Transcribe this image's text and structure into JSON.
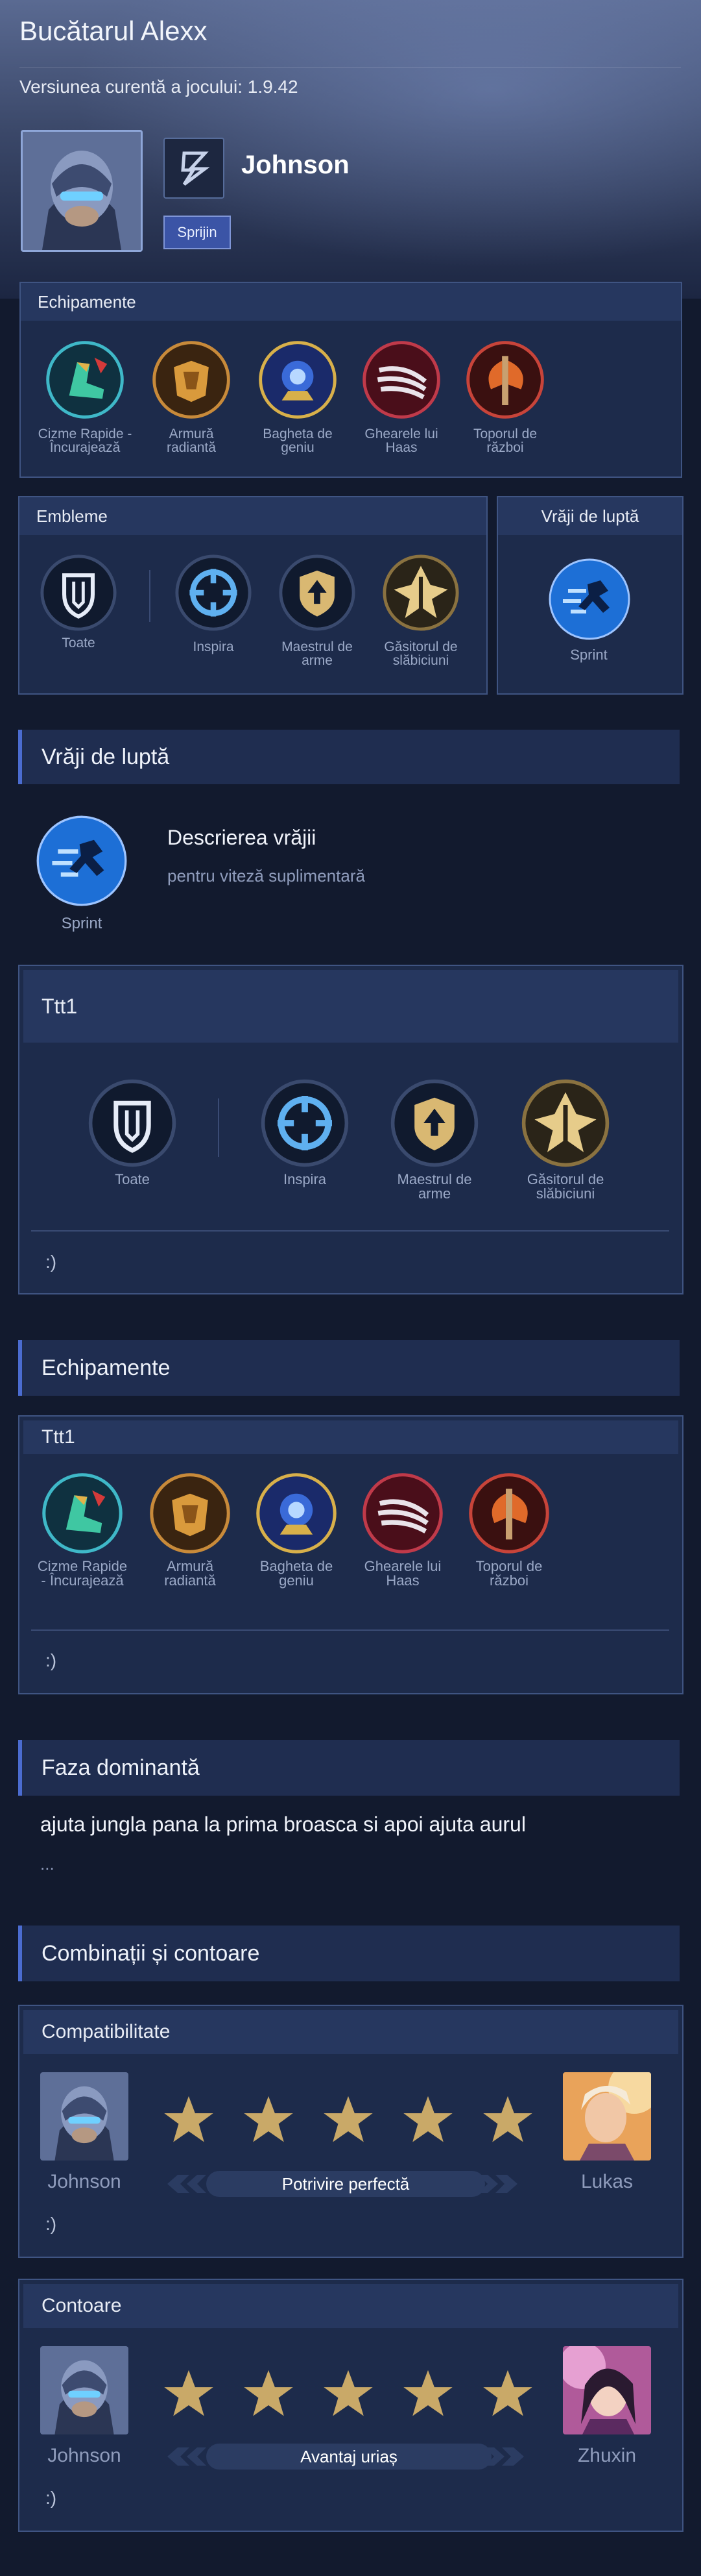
{
  "header": {
    "title": "Bucătarul Alexx",
    "version": "Versiunea curentă a jocului: 1.9.42"
  },
  "hero": {
    "name": "Johnson",
    "role": "Sprijin",
    "role_icon": "role-emblem-icon"
  },
  "top_equipment": {
    "title": "Echipamente",
    "items": [
      {
        "label": "Cizme Rapide - Încurajează",
        "icon": "boots-icon"
      },
      {
        "label": "Armură radiantă",
        "icon": "armor-icon"
      },
      {
        "label": "Bagheta de geniu",
        "icon": "wand-icon"
      },
      {
        "label": "Ghearele lui Haas",
        "icon": "claws-icon"
      },
      {
        "label": "Toporul de război",
        "icon": "axe-icon"
      }
    ]
  },
  "top_emblems": {
    "title": "Embleme",
    "items": [
      {
        "label": "Toate",
        "icon": "emblem-all-icon"
      },
      {
        "label": "Inspira",
        "icon": "inspire-icon"
      },
      {
        "label": "Maestrul de arme",
        "icon": "weapon-master-icon"
      },
      {
        "label": "Găsitorul de slăbiciuni",
        "icon": "weakness-finder-icon"
      }
    ]
  },
  "top_spell": {
    "title": "Vrăji de luptă",
    "label": "Sprint",
    "icon": "sprint-icon"
  },
  "battle_spells": {
    "heading": "Vrăji de luptă",
    "spell_label": "Sprint",
    "desc_title": "Descrierea vrăjii",
    "desc_text": "pentru viteză suplimentară"
  },
  "emblem_build": {
    "title": "Ttt1",
    "items": [
      {
        "label": "Toate",
        "icon": "emblem-all-icon"
      },
      {
        "label": "Inspira",
        "icon": "inspire-icon"
      },
      {
        "label": "Maestrul de arme",
        "icon": "weapon-master-icon"
      },
      {
        "label": "Găsitorul de slăbiciuni",
        "icon": "weakness-finder-icon"
      }
    ],
    "note": ":)"
  },
  "equipment_section": {
    "heading": "Echipamente",
    "build_title": "Ttt1",
    "items": [
      {
        "label": "Cizme Rapide - Încurajează",
        "icon": "boots-icon"
      },
      {
        "label": "Armură radiantă",
        "icon": "armor-icon"
      },
      {
        "label": "Bagheta de geniu",
        "icon": "wand-icon"
      },
      {
        "label": "Ghearele lui Haas",
        "icon": "claws-icon"
      },
      {
        "label": "Toporul de război",
        "icon": "axe-icon"
      }
    ],
    "note": ":)"
  },
  "dominant_phase": {
    "heading": "Faza dominantă",
    "text": "ajuta jungla pana la prima broasca si apoi ajuta aurul",
    "more": "..."
  },
  "combos": {
    "heading": "Combinații și contoare",
    "compat": {
      "title": "Compatibilitate",
      "left_name": "Johnson",
      "right_name": "Lukas",
      "rating": 5,
      "rating_max": 5,
      "pill": "Potrivire perfectă",
      "note": ":)"
    },
    "counter": {
      "title": "Contoare",
      "left_name": "Johnson",
      "right_name": "Zhuxin",
      "rating": 5,
      "rating_max": 5,
      "pill": "Avantaj uriaș",
      "note": ":)"
    }
  },
  "colors": {
    "background": "#121a2e",
    "panel": "#1e2c4e",
    "accent": "#4b6cd0",
    "star": "#c9a968",
    "label": "#9aa8c6"
  }
}
